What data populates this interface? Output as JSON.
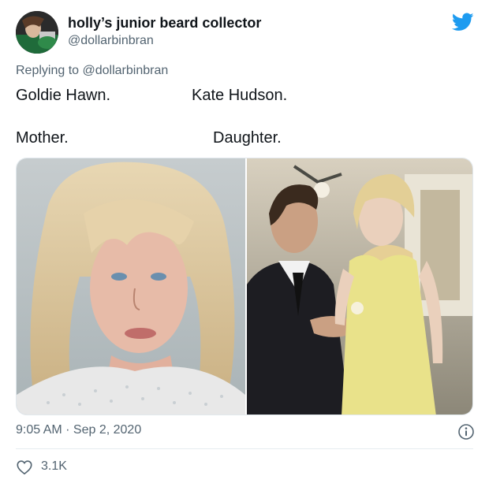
{
  "author": {
    "display_name": "holly’s junior beard collector",
    "handle": "@dollarbinbran"
  },
  "reply": {
    "prefix": "Replying to",
    "mention": "@dollarbinbran"
  },
  "tweet_text": {
    "left_name": "Goldie Hawn.",
    "right_name": "Kate Hudson.",
    "left_role": "Mother.",
    "right_role": "Daughter."
  },
  "media": {
    "left_photo": "woman-with-shaggy-blonde-hair-photo",
    "right_photo": "couple-man-in-suit-woman-in-yellow-dress-photo"
  },
  "meta": {
    "timestamp": "9:05 AM · Sep 2, 2020"
  },
  "engagement": {
    "likes": "3.1K"
  },
  "colors": {
    "twitter_blue": "#1d9bf0",
    "secondary_text": "#536471",
    "primary_text": "#0f1419"
  },
  "icons": {
    "brand": "twitter-bird-icon",
    "info": "info-icon",
    "like": "heart-icon"
  }
}
